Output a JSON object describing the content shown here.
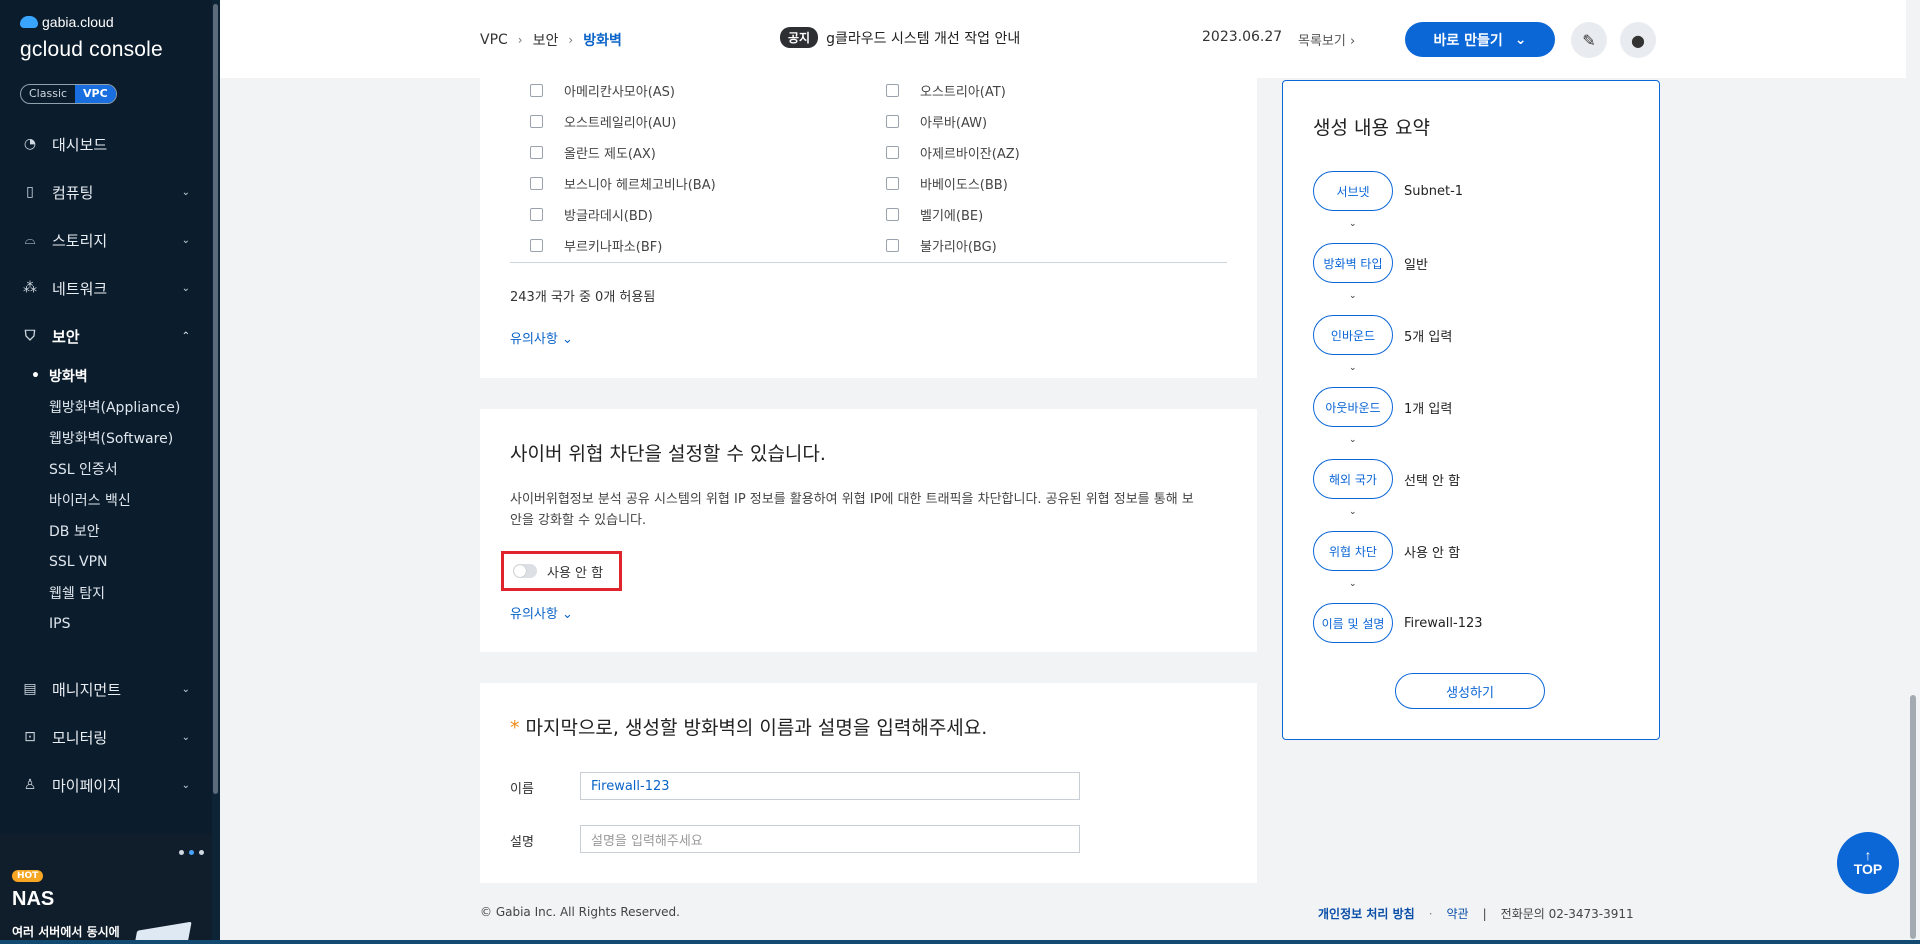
{
  "sidebar": {
    "brand_top": "gabia.cloud",
    "brand_main": "gcloud console",
    "mode_classic": "Classic",
    "mode_vpc": "VPC",
    "items": [
      {
        "label": "대시보드",
        "icon": "dashboard-icon"
      },
      {
        "label": "컴퓨팅",
        "icon": "chip-icon"
      },
      {
        "label": "스토리지",
        "icon": "storage-icon"
      },
      {
        "label": "네트워크",
        "icon": "network-icon"
      },
      {
        "label": "보안",
        "icon": "shield-icon"
      }
    ],
    "security_sub": [
      "방화벽",
      "웹방화벽(Appliance)",
      "웹방화벽(Software)",
      "SSL 인증서",
      "바이러스 백신",
      "DB 보안",
      "SSL VPN",
      "웹쉘 탐지",
      "IPS"
    ],
    "items_bottom": [
      {
        "label": "매니지먼트",
        "icon": "management-icon"
      },
      {
        "label": "모니터링",
        "icon": "monitor-icon"
      },
      {
        "label": "마이페이지",
        "icon": "user-icon"
      }
    ],
    "promo": {
      "badge": "HOT",
      "title": "NAS",
      "subtitle": "여러 서버에서 동시에"
    }
  },
  "header": {
    "breadcrumb": [
      "VPC",
      "보안",
      "방화벽"
    ],
    "notice_badge": "공지",
    "notice_text": "g클라우드 시스템 개선 작업 안내",
    "notice_date": "2023.06.27",
    "notice_list": "목록보기",
    "create_button": "바로 만들기"
  },
  "countries": {
    "left": [
      "아메리칸사모아(AS)",
      "오스트레일리아(AU)",
      "올란드 제도(AX)",
      "보스니아 헤르체고비나(BA)",
      "방글라데시(BD)",
      "부르키나파소(BF)"
    ],
    "right": [
      "오스트리아(AT)",
      "아루바(AW)",
      "아제르바이잔(AZ)",
      "바베이도스(BB)",
      "벨기에(BE)",
      "불가리아(BG)"
    ],
    "count_text": "243개 국가 중 0개 허용됨",
    "note_link": "유의사항"
  },
  "threat": {
    "title": "사이버 위협 차단을 설정할 수 있습니다.",
    "desc_line1": "사이버위협정보 분석 공유 시스템의 위협 IP 정보를 활용하여 위협 IP에 대한 트래픽을 차단합니다. 공유된 위협 정보를 통해 보",
    "desc_line2": "안을 강화할 수 있습니다.",
    "toggle_label": "사용 안 함",
    "note_link": "유의사항"
  },
  "name_section": {
    "star": "*",
    "title": "마지막으로, 생성할 방화벽의 이름과 설명을 입력해주세요.",
    "name_label": "이름",
    "name_value": "Firewall-123",
    "desc_label": "설명",
    "desc_placeholder": "설명을 입력해주세요"
  },
  "summary": {
    "title": "생성 내용 요약",
    "steps": [
      {
        "label": "서브넷",
        "value": "Subnet-1"
      },
      {
        "label": "방화벽 타입",
        "value": "일반"
      },
      {
        "label": "인바운드",
        "value": "5개 입력"
      },
      {
        "label": "아웃바운드",
        "value": "1개 입력"
      },
      {
        "label": "해외 국가",
        "value": "선택 안 함"
      },
      {
        "label": "위협 차단",
        "value": "사용 안 함"
      },
      {
        "label": "이름 및 설명",
        "value": "Firewall-123"
      }
    ],
    "create_button": "생성하기"
  },
  "footer": {
    "copyright": "© Gabia Inc. All Rights Reserved.",
    "privacy": "개인정보 처리 방침",
    "dot": "·",
    "terms": "약관",
    "pipe": "|",
    "phone": "전화문의  02-3473-3911"
  },
  "top_button": "TOP",
  "colors": {
    "accent": "#0b66d6",
    "sidebar_bg": "#0b1c2c",
    "highlight": "#e0242c"
  }
}
